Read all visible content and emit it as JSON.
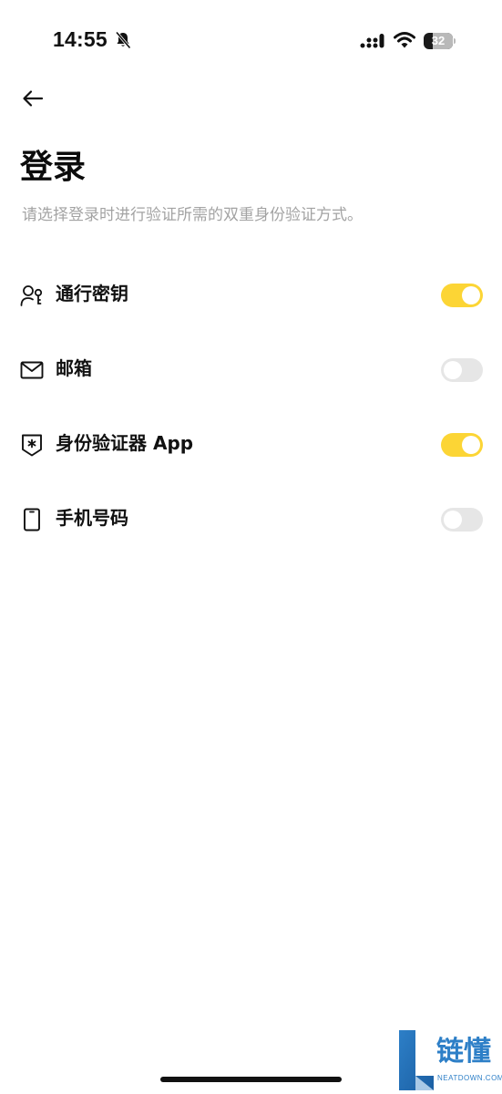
{
  "status_bar": {
    "time": "14:55",
    "battery_level": "32",
    "battery_fraction": 0.32
  },
  "header": {
    "back_icon": "arrow-left-icon",
    "title": "登录",
    "subtitle": "请选择登录时进行验证所需的双重身份验证方式。"
  },
  "options": [
    {
      "icon": "passkey-icon",
      "label": "通行密钥",
      "enabled": true
    },
    {
      "icon": "mail-icon",
      "label": "邮箱",
      "enabled": false
    },
    {
      "icon": "authenticator-shield-icon",
      "label": "身份验证器 App",
      "enabled": true
    },
    {
      "icon": "phone-icon",
      "label": "手机号码",
      "enabled": false
    }
  ],
  "watermark": {
    "text": "链懂",
    "sub": "NEATDOWN.COM"
  },
  "colors": {
    "toggle_on": "#fcd535",
    "toggle_off": "#e6e6e6",
    "subtitle_gray": "#a3a3a3",
    "watermark_blue": "#2d7fc7"
  }
}
